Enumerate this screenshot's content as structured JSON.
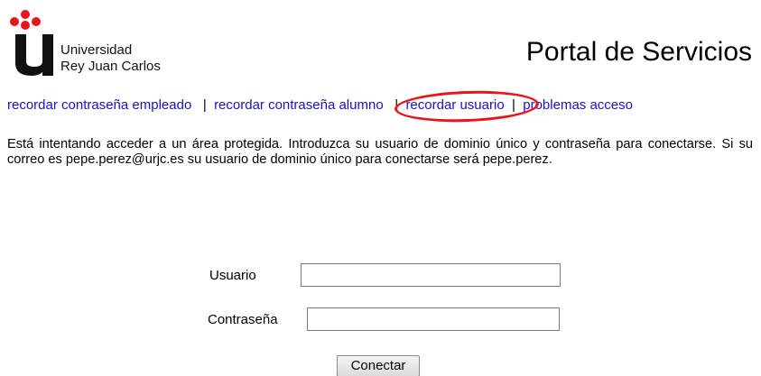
{
  "branding": {
    "university_line1": "Universidad",
    "university_line2": "Rey Juan Carlos",
    "accent_color": "#e8161b",
    "logo_letter_color": "#111111"
  },
  "header": {
    "title": "Portal de Servicios"
  },
  "links": {
    "employee_password": "recordar contraseña empleado",
    "student_password": "recordar contraseña alumno",
    "remember_user": "recordar usuario",
    "access_problems": "problemas acceso",
    "separator": "|",
    "link_color": "#1a10c8"
  },
  "notice": {
    "text": "Está intentando acceder a un área protegida. Introduzca su usuario de dominio único y contraseña para conectarse. Si su correo es pepe.perez@urjc.es su usuario de dominio único para conectarse será pepe.perez."
  },
  "form": {
    "username_label": "Usuario",
    "username_value": "",
    "password_label": "Contraseña",
    "password_value": "",
    "submit_label": "Conectar"
  }
}
